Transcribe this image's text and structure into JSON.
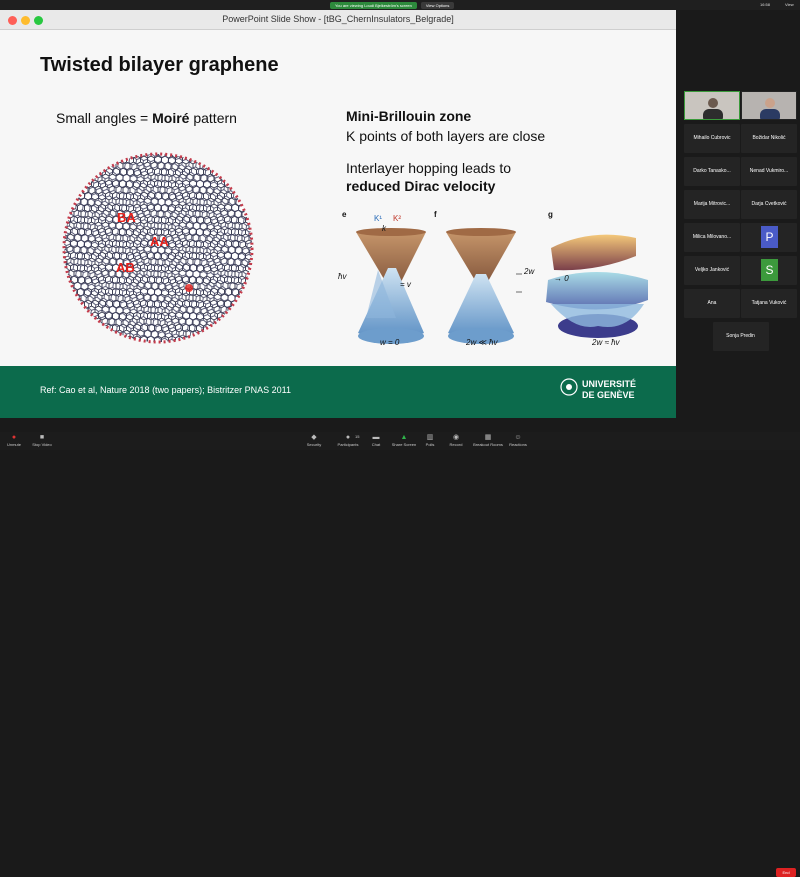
{
  "zoom": {
    "share_banner": "You are viewing Loudi Bjelkeström's screen",
    "view_options": "View Options",
    "clock": "16:58",
    "view_label": "View"
  },
  "window": {
    "title": "PowerPoint Slide Show - [tBG_ChernInsulators_Belgrade]"
  },
  "slide": {
    "title": "Twisted bilayer graphene",
    "small_angles_prefix": "Small angles = ",
    "small_angles_bold": "Moiré",
    "small_angles_suffix": " pattern",
    "mbz_title": "Mini-Brillouin zone",
    "k_points": "K points of both layers are close",
    "hopping_line1": "Interlayer hopping leads to",
    "hopping_line2": "reduced Dirac velocity",
    "stacking": {
      "ba": "BA",
      "aa": "AA",
      "ab": "AB"
    },
    "panels": {
      "e": {
        "label": "e",
        "k1": "K¹",
        "k2": "K²",
        "ktheta": "k",
        "vf": "v",
        "vf_eq": "= v",
        "hbar": "ħv",
        "hbar_k": "k",
        "w_eq": "w = 0"
      },
      "f": {
        "label": "f",
        "two_w": "2w",
        "cond": "2w ≪ ħv",
        "cond_k": "k"
      },
      "g": {
        "label": "g",
        "vf_zero": "→ 0",
        "cond": "2w ≈ ħv",
        "cond_k": "k"
      }
    },
    "reference": "Ref: Cao et al, Nature 2018 (two papers); Bistritzer PNAS 2011",
    "university_line1": "UNIVERSITÉ",
    "university_line2": "DE GENÈVE"
  },
  "participants": [
    {
      "name": "Mihailo Cubrovic",
      "type": "name"
    },
    {
      "name": "Božidar Nikolić",
      "type": "name"
    },
    {
      "name": "Darko Tanasko...",
      "type": "name"
    },
    {
      "name": "Nenad Vukmiro...",
      "type": "name"
    },
    {
      "name": "Marija Mitrovic...",
      "type": "name"
    },
    {
      "name": "Darja Cvetković",
      "type": "name"
    },
    {
      "name": "Milica Milovano...",
      "type": "name"
    },
    {
      "name": "P",
      "type": "avatar",
      "color": "#4a5bc7"
    },
    {
      "name": "Veljko Janković",
      "type": "name"
    },
    {
      "name": "S",
      "type": "avatar",
      "color": "#3c9a3c"
    },
    {
      "name": "Ana",
      "type": "name"
    },
    {
      "name": "Tatjana Vuković",
      "type": "name"
    },
    {
      "name": "Sonja Predin",
      "type": "name"
    }
  ],
  "toolbar": {
    "unmute": "Unmute",
    "stop_video": "Stop Video",
    "security": "Security",
    "participants": "Participants",
    "participants_count": "15",
    "chat": "Chat",
    "share_screen": "Share Screen",
    "polls": "Polls",
    "record": "Record",
    "breakout_rooms": "Breakout Rooms",
    "reactions": "Reactions",
    "end": "End"
  },
  "colors": {
    "green_band": "#0c6b4c",
    "stacking_red": "#e8211b",
    "end_red": "#dd2222"
  }
}
